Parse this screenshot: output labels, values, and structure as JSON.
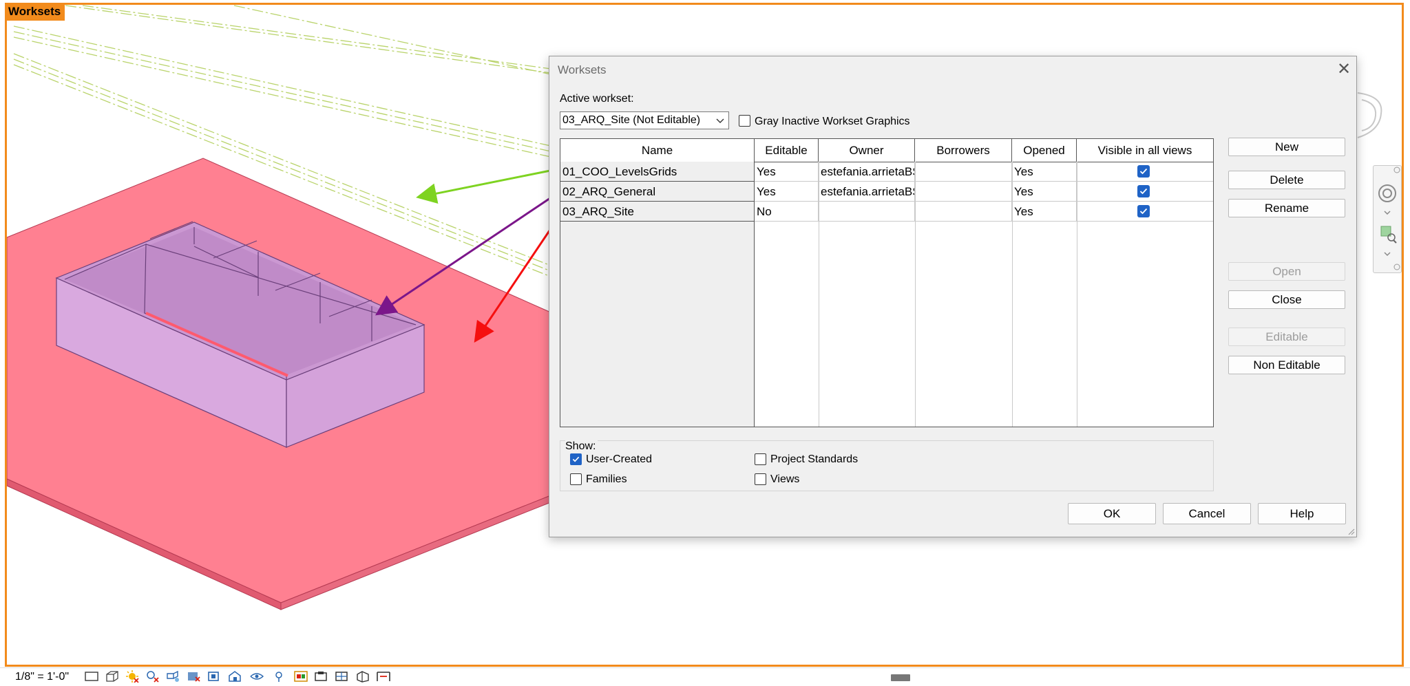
{
  "view": {
    "tag": "Worksets",
    "frame_color": "#f28b1c",
    "floor_color": "#ff8091",
    "box_color": "#d9a9df",
    "arrow_colors": [
      "#7ed321",
      "#7b168a",
      "#f50f0f"
    ]
  },
  "statusbar": {
    "scale": "1/8\" = 1'-0\"",
    "icons": [
      "detail-level-icon",
      "visual-style-icon",
      "sun-path-icon",
      "shadows-icon",
      "render-icon",
      "crop-view-icon",
      "show-crop-icon",
      "unlock-3d-icon",
      "temporary-hide-icon",
      "reveal-hidden-icon",
      "worksharing-display-icon",
      "temporary-view-properties-icon",
      "analytical-model-icon",
      "highlight-displacement-icon",
      "reveal-constraints-icon"
    ]
  },
  "dialog": {
    "title": "Worksets",
    "close_icon": "close-icon",
    "active_workset_label": "Active workset:",
    "active_workset_value": "03_ARQ_Site (Not Editable)",
    "gray_inactive_label": "Gray Inactive Workset Graphics",
    "gray_inactive_checked": false,
    "columns": [
      "Name",
      "Editable",
      "Owner",
      "Borrowers",
      "Opened",
      "Visible in all views"
    ],
    "rows": [
      {
        "name": "01_COO_LevelsGrids",
        "editable": "Yes",
        "owner": "estefania.arrietaBS",
        "borrowers": "",
        "opened": "Yes",
        "visible": true
      },
      {
        "name": "02_ARQ_General",
        "editable": "Yes",
        "owner": "estefania.arrietaBS",
        "borrowers": "",
        "opened": "Yes",
        "visible": true
      },
      {
        "name": "03_ARQ_Site",
        "editable": "No",
        "owner": "",
        "borrowers": "",
        "opened": "Yes",
        "visible": true
      }
    ],
    "buttons": {
      "new": "New",
      "delete": "Delete",
      "rename": "Rename",
      "open": "Open",
      "close": "Close",
      "editable": "Editable",
      "non_editable": "Non Editable"
    },
    "show": {
      "label": "Show:",
      "user_created": {
        "label": "User-Created",
        "checked": true
      },
      "families": {
        "label": "Families",
        "checked": false
      },
      "project_standards": {
        "label": "Project Standards",
        "checked": false
      },
      "views": {
        "label": "Views",
        "checked": false
      }
    },
    "footer": {
      "ok": "OK",
      "cancel": "Cancel",
      "help": "Help"
    },
    "accent_color": "#1f63c6"
  }
}
